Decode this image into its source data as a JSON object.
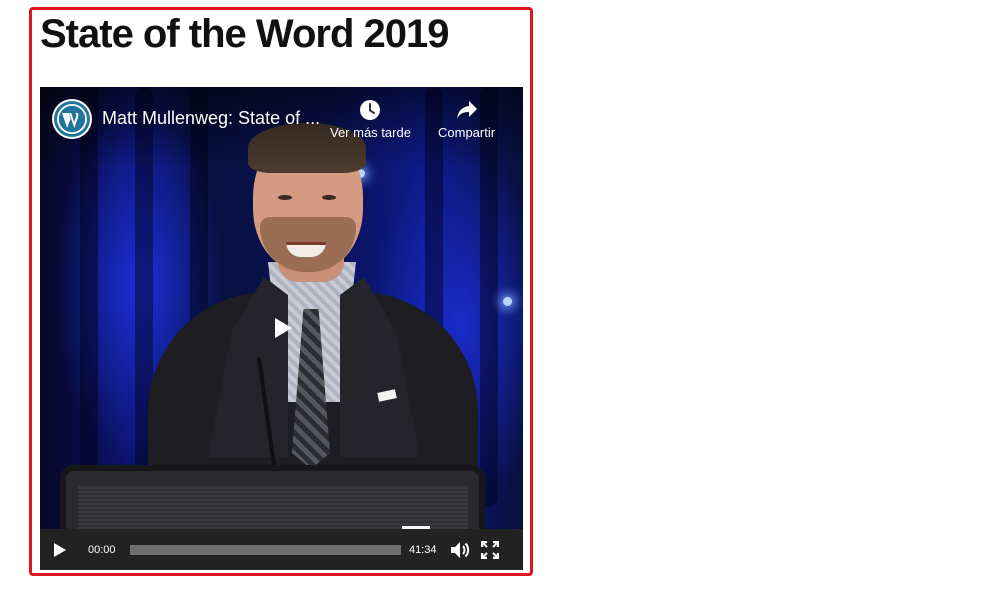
{
  "post": {
    "title": "State of the Word 2019"
  },
  "video": {
    "channel_logo": "wordpress-logo",
    "title": "Matt Mullenweg: State of ...",
    "actions": {
      "watch_later": {
        "icon": "clock-icon",
        "label": "Ver más tarde"
      },
      "share": {
        "icon": "share-arrow-icon",
        "label": "Compartir"
      }
    },
    "big_play_icon": "play-icon",
    "controls": {
      "play_icon": "play-icon",
      "current_time": "00:00",
      "total_time": "41:34",
      "progress": 0,
      "volume_icon": "volume-icon",
      "fullscreen_icon": "fullscreen-icon"
    }
  },
  "colors": {
    "highlight": "#e0161f",
    "control_bar": "#222222",
    "progress_track": "#6f6f6f"
  }
}
